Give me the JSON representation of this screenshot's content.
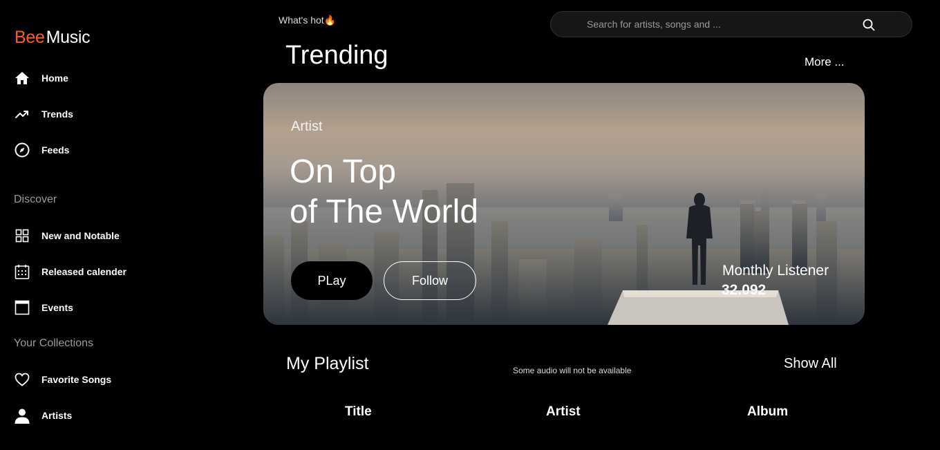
{
  "brand": {
    "bee": "Bee",
    "music": "Music",
    "accent": "#ff5a1f"
  },
  "sidebar": {
    "main_items": [
      {
        "label": "Home",
        "icon": "home-icon"
      },
      {
        "label": "Trends",
        "icon": "trending-up-icon"
      },
      {
        "label": "Feeds",
        "icon": "compass-icon"
      }
    ],
    "discover_title": "Discover",
    "discover_items": [
      {
        "label": "New and Notable",
        "icon": "grid-icon"
      },
      {
        "label": "Released calender",
        "icon": "calendar-icon"
      },
      {
        "label": "Events",
        "icon": "window-icon"
      }
    ],
    "collections_title": "Your Collections",
    "collection_items": [
      {
        "label": "Favorite Songs",
        "icon": "heart-icon"
      },
      {
        "label": "Artists",
        "icon": "user-icon"
      }
    ]
  },
  "header": {
    "whats_hot": "What's hot🔥",
    "search_placeholder": "Search for artists, songs and ..."
  },
  "trending": {
    "title": "Trending",
    "more_label": "More ..."
  },
  "hero": {
    "artist_label": "Artist",
    "title_line1": "On Top",
    "title_line2": "of The World",
    "play_label": "PLay",
    "follow_label": "Follow",
    "listener_label": "Monthly Listener",
    "listener_value": "32.092"
  },
  "playlist": {
    "title": "My Playlist",
    "note": "Some audio will not be available",
    "show_all_label": "Show All",
    "columns": [
      "Title",
      "Artist",
      "Album"
    ]
  }
}
